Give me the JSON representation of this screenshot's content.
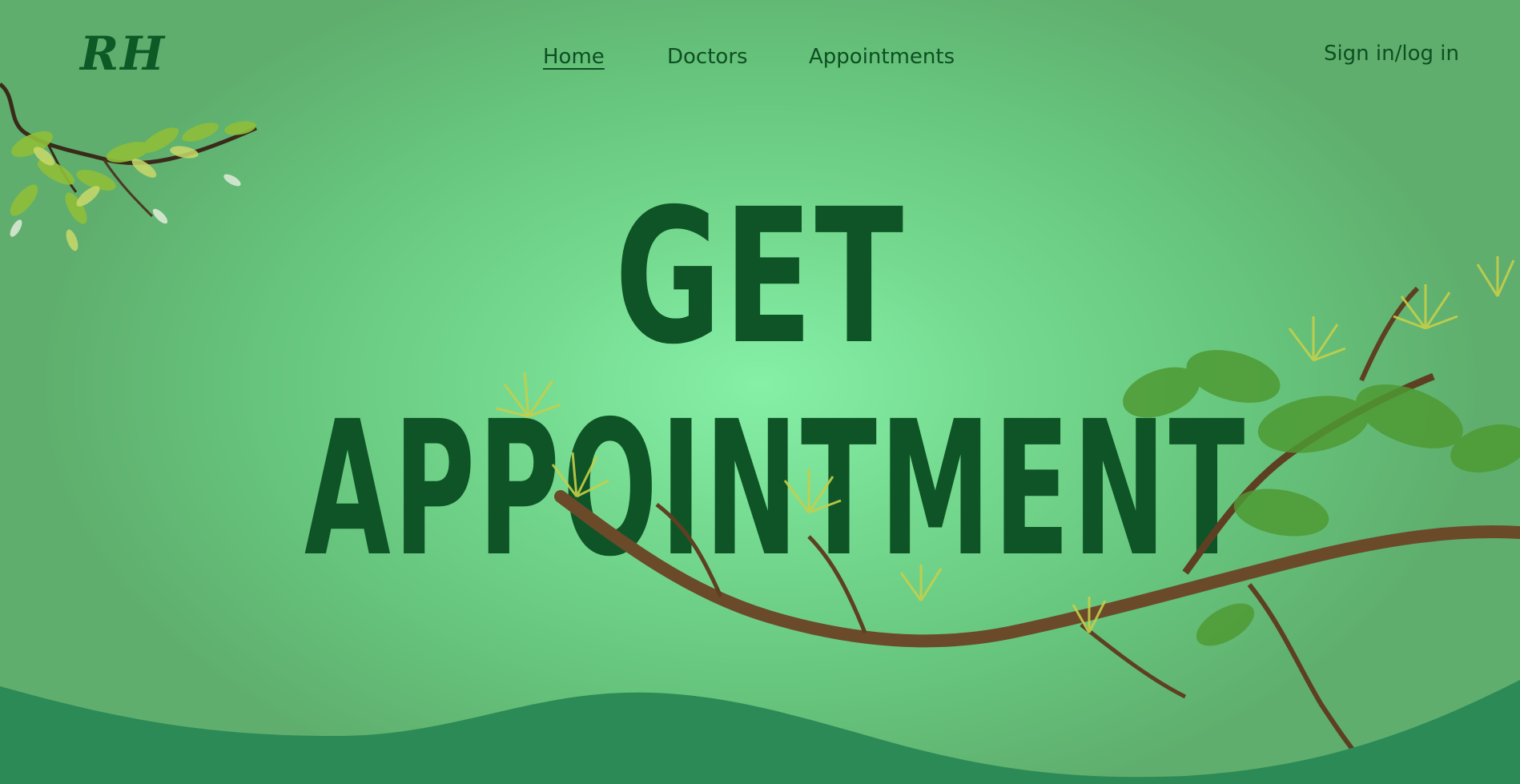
{
  "logo": {
    "text": "RH"
  },
  "nav": {
    "items": [
      {
        "label": "Home",
        "active": true
      },
      {
        "label": "Doctors",
        "active": false
      },
      {
        "label": "Appointments",
        "active": false
      }
    ],
    "signin_label": "Sign in/log in"
  },
  "hero": {
    "line1": "GET",
    "line2": "APPOINTMENT"
  },
  "colors": {
    "background": "#74d98f",
    "text_dark_green": "#0f5426",
    "wave": "#2c8a57"
  },
  "icons": {
    "top_left_branch": "leafy-branch-icon",
    "right_branch": "pine-branch-icon"
  }
}
